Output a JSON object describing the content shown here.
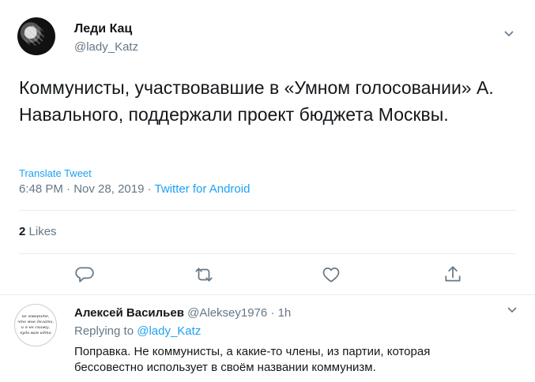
{
  "tweet": {
    "author_name": "Леди Кац",
    "author_handle": "@lady_Katz",
    "text": "Коммунисты, участвовавшие в «Умном голосовании» А. Навального, поддержали проект бюджета Москвы.",
    "translate_label": "Translate Tweet",
    "time": "6:48 PM",
    "date": "Nov 28, 2019",
    "dot": "·",
    "source_app": "Twitter for Android",
    "likes_count": "2",
    "likes_label": "Likes",
    "icons": [
      "reply-icon",
      "retweet-icon",
      "like-icon",
      "share-icon",
      "chevron-down-icon"
    ]
  },
  "reply": {
    "author_name": "Алексей Васильев",
    "author_handle": "@Aleksey1976",
    "dot": "·",
    "age": "1h",
    "replying_prefix": "Replying to",
    "replying_mention": "@lady_Katz",
    "text": "Поправка. Не коммунисты, а какие-то члены, из партии, которая бессовестно использует в своём названии коммунизм.",
    "avatar_lines": [
      "не говорите,",
      "что мне делать,",
      "и я не скажу,",
      "куда вам идти"
    ]
  },
  "colors": {
    "accent": "#1da1f2",
    "muted": "#657786",
    "text": "#14171a",
    "divider": "#e6ecf0"
  }
}
